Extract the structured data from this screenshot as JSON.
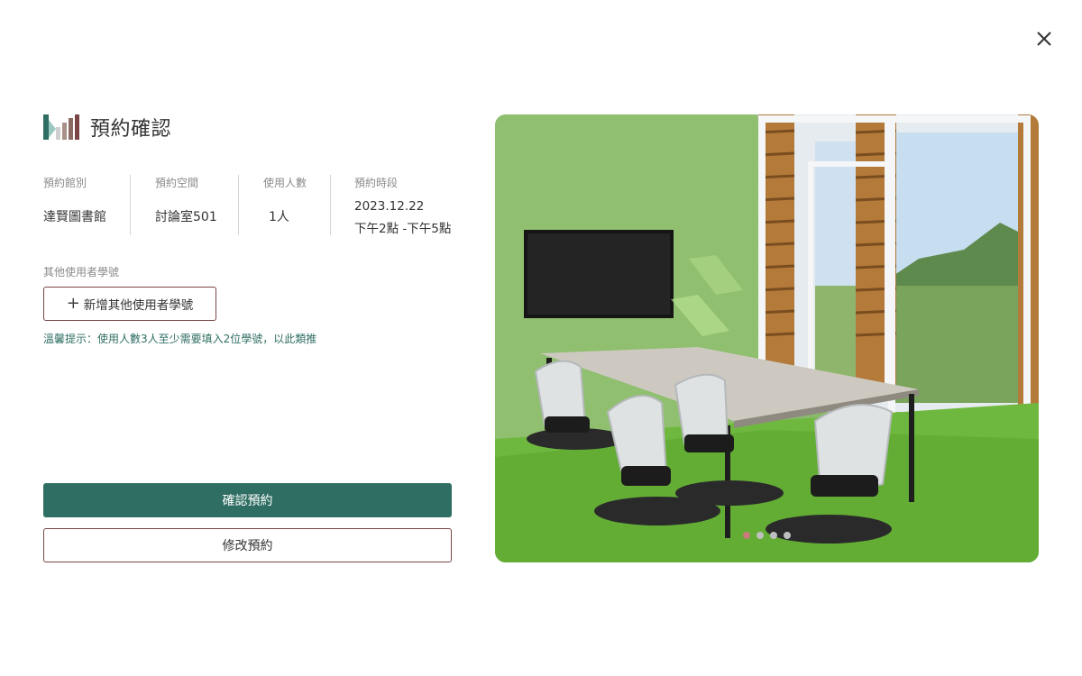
{
  "title": "預約確認",
  "info": {
    "library_label": "預約館別",
    "library_value": "達賢圖書館",
    "space_label": "預約空間",
    "space_value": "討論室501",
    "people_label": "使用人數",
    "people_value": "1人",
    "time_label": "預約時段",
    "date_value": "2023.12.22",
    "time_value": "下午2點 -下午5點"
  },
  "other_users": {
    "label": "其他使用者學號",
    "add_button": "新增其他使用者學號",
    "hint": "溫馨提示：使用人數3人至少需要填入2位學號，以此類推"
  },
  "actions": {
    "confirm": "確認預約",
    "modify": "修改預約"
  },
  "carousel": {
    "slide_count": 4,
    "active_index": 0
  },
  "icons": {
    "close": "close-icon",
    "logo": "library-logo-icon",
    "add": "plus-icon"
  },
  "colors": {
    "primary": "#2f6e63",
    "border_accent": "#7a4545",
    "active_dot": "#c97b7b"
  }
}
